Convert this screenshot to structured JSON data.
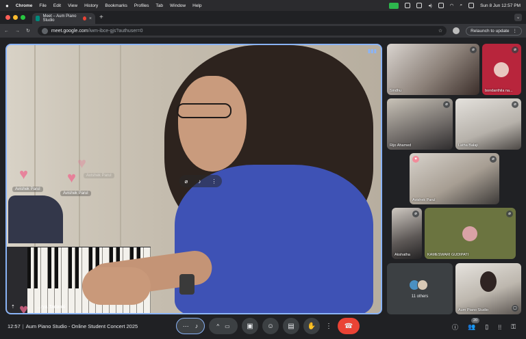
{
  "menubar": {
    "app": "Chrome",
    "items": [
      "File",
      "Edit",
      "View",
      "History",
      "Bookmarks",
      "Profiles",
      "Tab",
      "Window",
      "Help"
    ],
    "datetime": "Sun 8 Jun  12:57 PM"
  },
  "tab": {
    "title": "Meet – Aum Piano Studio",
    "new_tab": "+",
    "close": "×"
  },
  "address": {
    "host": "meet.google.com",
    "path": "/iwm-ibce-gjs?authuser=0",
    "relaunch": "Relaunch to update"
  },
  "main_video": {
    "name": "...rya Tadanki",
    "bubble_names": [
      "Avishek Parul",
      "Avishek Parul",
      "Avishek Parul"
    ]
  },
  "participants": [
    {
      "name": "Sindhu"
    },
    {
      "name": "bondanthila na..."
    },
    {
      "name": "Rijo Ahamed"
    },
    {
      "name": "Latha Balaji"
    },
    {
      "name": "Avishek Parul"
    },
    {
      "name": "Akshatha"
    },
    {
      "name": "KAMESWARI GUDIPATI"
    },
    {
      "name": "Aum Piano Studio"
    }
  ],
  "others": {
    "label": "11 others"
  },
  "bottom": {
    "time": "12:57",
    "separator": "|",
    "meeting_title": "Aum Piano Studio - Online Student Concert 2025",
    "people_count": "20"
  },
  "colors": {
    "accent": "#8ab4f8",
    "end_call": "#ea4335",
    "heart": "#ee6a8f"
  }
}
